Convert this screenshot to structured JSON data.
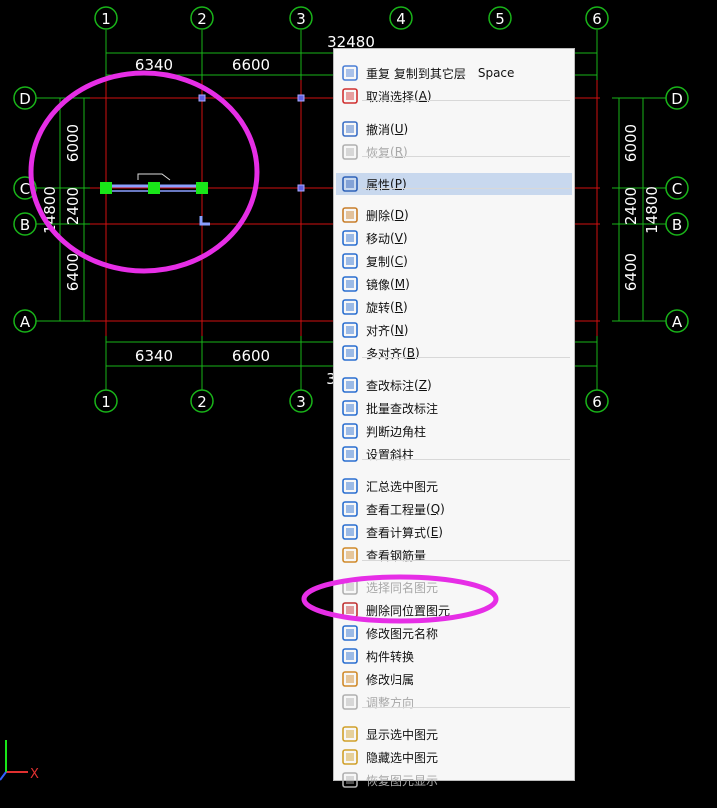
{
  "drawing": {
    "top_axes": [
      "1",
      "2",
      "3",
      "4",
      "5",
      "6"
    ],
    "bottom_axes": [
      "1",
      "2",
      "3",
      "6"
    ],
    "row_axes": [
      "D",
      "C",
      "B",
      "A"
    ],
    "top_dims": [
      "6340",
      "6600"
    ],
    "bottom_dims": [
      "6340",
      "6600"
    ],
    "overall_top": "32480",
    "overall_bottom_fragment": "3",
    "left_dims": [
      "6000",
      "2400",
      "6400"
    ],
    "left_total": "14800",
    "right_dims": [
      "6000",
      "2400",
      "6400"
    ],
    "right_total": "14800",
    "ucs_x": "X",
    "colors": {
      "grid": "#d01010",
      "dim": "#19b419",
      "axis_bubble": "#ffffff",
      "highlight": "#e62ee6",
      "grip": "#19e619"
    }
  },
  "menu": {
    "items": [
      {
        "label": "重复 复制到其它层",
        "hotkey": "",
        "shortcut": "Space",
        "icon": "repeat-icon",
        "disabled": false
      },
      {
        "label": "取消选择",
        "hotkey": "A",
        "shortcut": "",
        "icon": "deselect-icon",
        "disabled": false
      },
      {
        "label": "撤消",
        "hotkey": "U",
        "shortcut": "",
        "icon": "undo-icon",
        "disabled": false
      },
      {
        "label": "恢复",
        "hotkey": "R",
        "shortcut": "",
        "icon": "redo-icon",
        "disabled": true
      },
      {
        "label": "属性",
        "hotkey": "P",
        "shortcut": "",
        "icon": "properties-icon",
        "disabled": false,
        "selected": true
      },
      {
        "label": "删除",
        "hotkey": "D",
        "shortcut": "",
        "icon": "delete-icon",
        "disabled": false
      },
      {
        "label": "移动",
        "hotkey": "V",
        "shortcut": "",
        "icon": "move-icon",
        "disabled": false
      },
      {
        "label": "复制",
        "hotkey": "C",
        "shortcut": "",
        "icon": "copy-icon",
        "disabled": false
      },
      {
        "label": "镜像",
        "hotkey": "M",
        "shortcut": "",
        "icon": "mirror-icon",
        "disabled": false
      },
      {
        "label": "旋转",
        "hotkey": "R",
        "shortcut": "",
        "icon": "rotate-icon",
        "disabled": false
      },
      {
        "label": "对齐",
        "hotkey": "N",
        "shortcut": "",
        "icon": "align-icon",
        "disabled": false
      },
      {
        "label": "多对齐",
        "hotkey": "B",
        "shortcut": "",
        "icon": "multi-align-icon",
        "disabled": false
      },
      {
        "label": "查改标注",
        "hotkey": "Z",
        "shortcut": "",
        "icon": "edit-annotation-icon",
        "disabled": false
      },
      {
        "label": "批量查改标注",
        "hotkey": "",
        "shortcut": "",
        "icon": "batch-annotation-icon",
        "disabled": false
      },
      {
        "label": "判断边角柱",
        "hotkey": "",
        "shortcut": "",
        "icon": "corner-column-icon",
        "disabled": false
      },
      {
        "label": "设置斜柱",
        "hotkey": "",
        "shortcut": "",
        "icon": "slanted-column-icon",
        "disabled": false
      },
      {
        "label": "汇总选中图元",
        "hotkey": "",
        "shortcut": "",
        "icon": "sum-icon",
        "disabled": false
      },
      {
        "label": "查看工程量",
        "hotkey": "Q",
        "shortcut": "",
        "icon": "quantity-icon",
        "disabled": false
      },
      {
        "label": "查看计算式",
        "hotkey": "E",
        "shortcut": "",
        "icon": "formula-icon",
        "disabled": false
      },
      {
        "label": "查看钢筋量",
        "hotkey": "",
        "shortcut": "",
        "icon": "rebar-icon",
        "disabled": false
      },
      {
        "label": "选择同名图元",
        "hotkey": "",
        "shortcut": "",
        "icon": "select-same-icon",
        "disabled": true
      },
      {
        "label": "删除同位置图元",
        "hotkey": "",
        "shortcut": "",
        "icon": "delete-overlap-icon",
        "disabled": false
      },
      {
        "label": "修改图元名称",
        "hotkey": "",
        "shortcut": "",
        "icon": "rename-icon",
        "disabled": false
      },
      {
        "label": "构件转换",
        "hotkey": "",
        "shortcut": "",
        "icon": "convert-icon",
        "disabled": false
      },
      {
        "label": "修改归属",
        "hotkey": "",
        "shortcut": "",
        "icon": "ownership-icon",
        "disabled": false
      },
      {
        "label": "调整方向",
        "hotkey": "",
        "shortcut": "",
        "icon": "direction-icon",
        "disabled": true
      },
      {
        "label": "显示选中图元",
        "hotkey": "",
        "shortcut": "",
        "icon": "show-icon",
        "disabled": false
      },
      {
        "label": "隐藏选中图元",
        "hotkey": "",
        "shortcut": "",
        "icon": "hide-icon",
        "disabled": false
      },
      {
        "label": "恢复图元显示",
        "hotkey": "",
        "shortcut": "",
        "icon": "restore-display-icon",
        "disabled": true
      }
    ]
  }
}
